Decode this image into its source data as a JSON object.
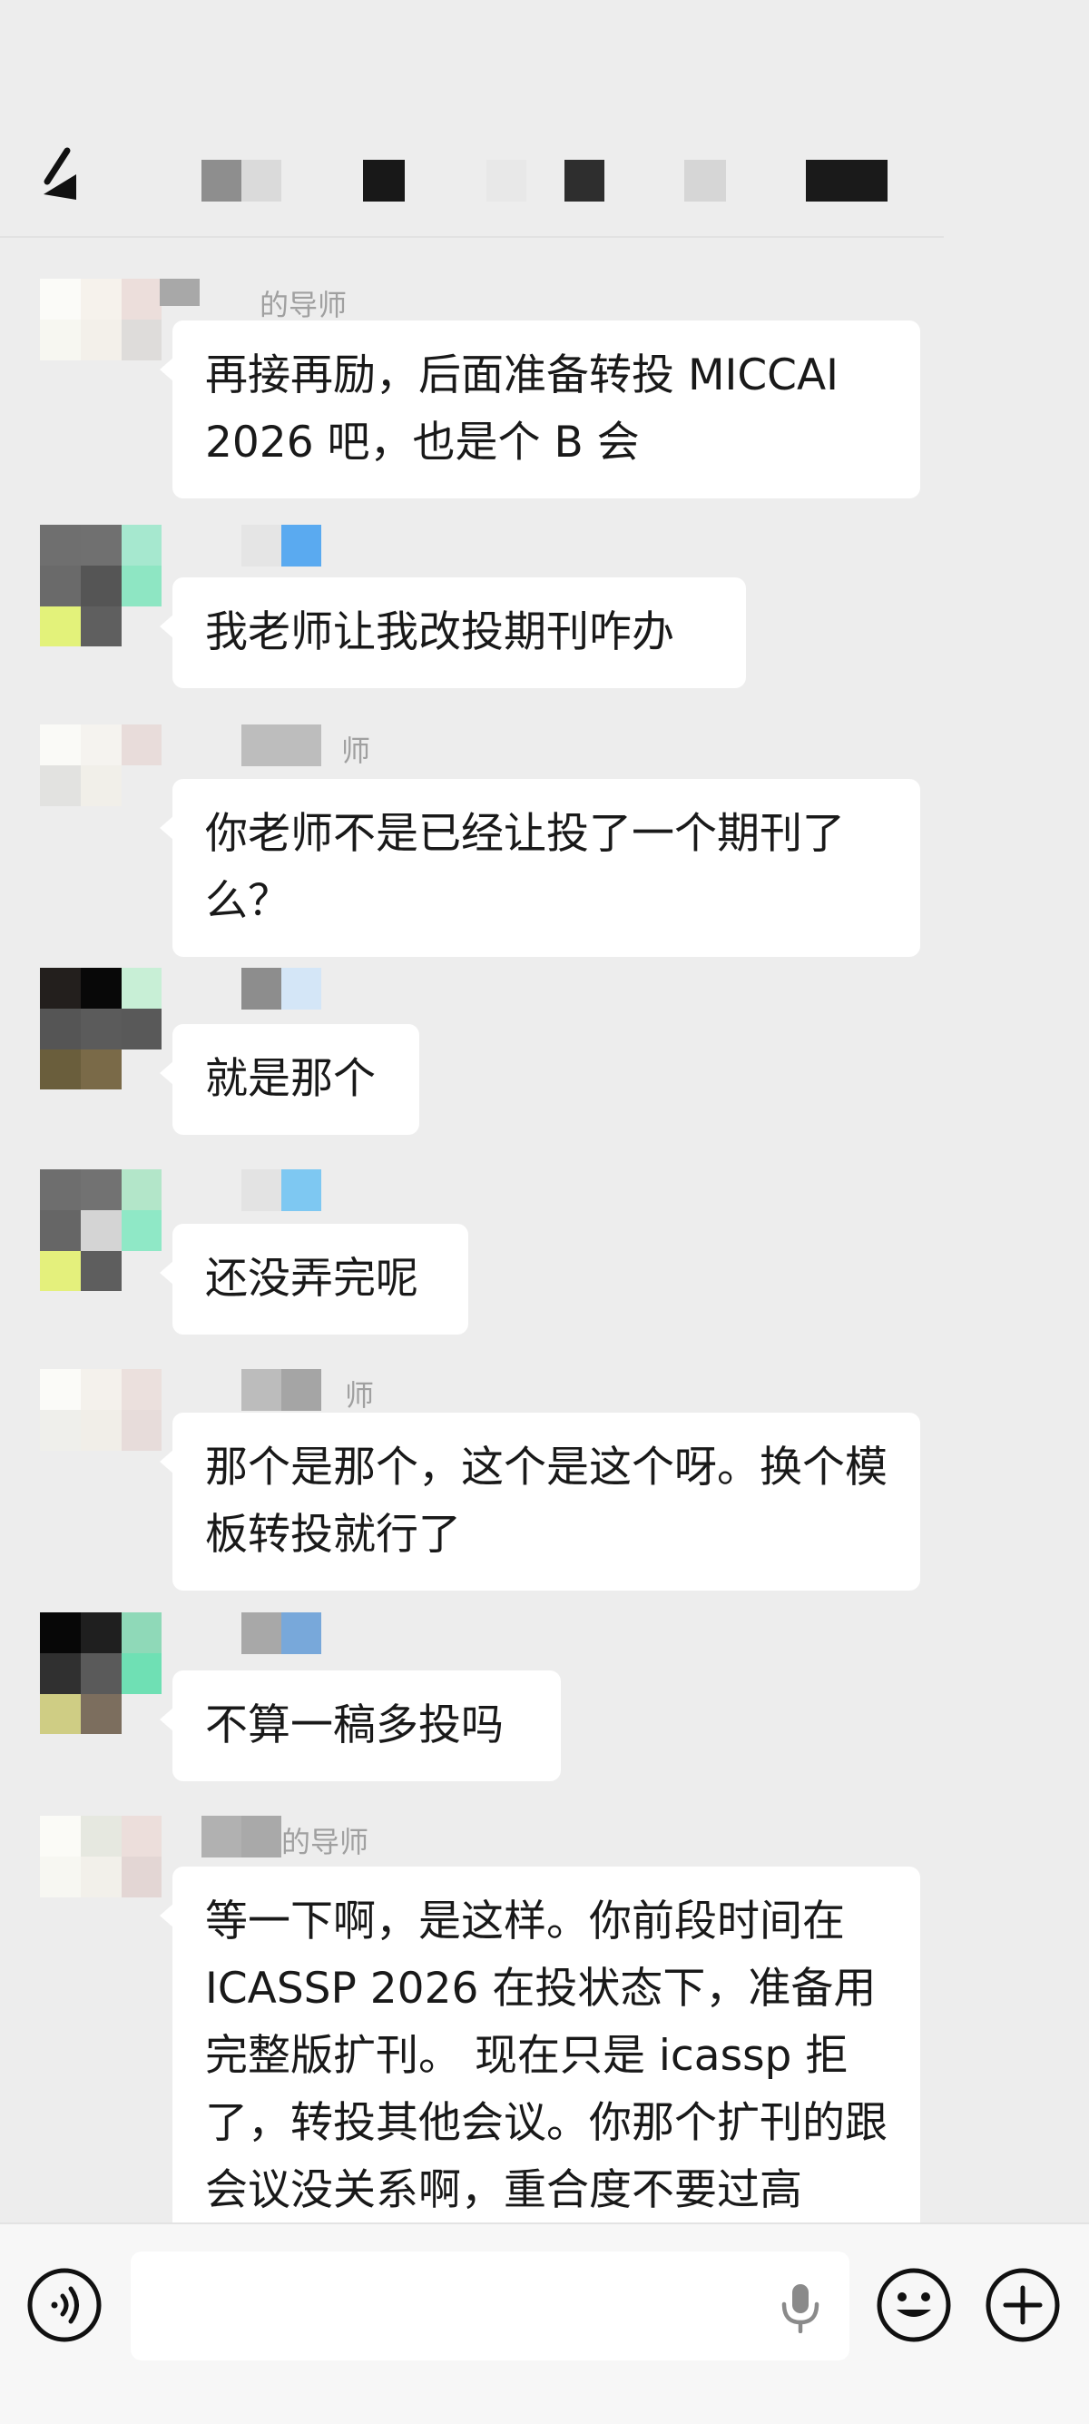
{
  "header": {
    "back_icon": "chevron-left-icon",
    "title_redacted": true
  },
  "messages": [
    {
      "sender_visible": "的导师",
      "text": "再接再励，后面准备转投 MICCAI 2026 吧，也是个 B 会"
    },
    {
      "sender_visible": "",
      "text": "我老师让我改投期刊咋办"
    },
    {
      "sender_visible": "师",
      "text": "你老师不是已经让投了一个期刊了么？"
    },
    {
      "sender_visible": "",
      "text": "就是那个"
    },
    {
      "sender_visible": "",
      "text": "还没弄完呢"
    },
    {
      "sender_visible": "师",
      "text": "那个是那个，这个是这个呀。换个模板转投就行了"
    },
    {
      "sender_visible": "",
      "text": "不算一稿多投吗"
    },
    {
      "sender_visible": "的导师",
      "text": "等一下啊，是这样。你前段时间在 ICASSP 2026 在投状态下，准备用完整版扩刊。 现在只是 icassp 拒了，转投其他会议。你那个扩刊的跟会议没关系啊，重合度不要过高"
    }
  ],
  "input_bar": {
    "voice_icon": "voice-mode-icon",
    "mic_icon": "microphone-icon",
    "emoji_icon": "emoji-icon",
    "add_icon": "plus-circle-icon",
    "input_value": ""
  },
  "colors": {
    "background": "#ededed",
    "bubble": "#ffffff",
    "text": "#191919",
    "name": "#a0a0a0",
    "input_bar": "#f7f7f7"
  }
}
